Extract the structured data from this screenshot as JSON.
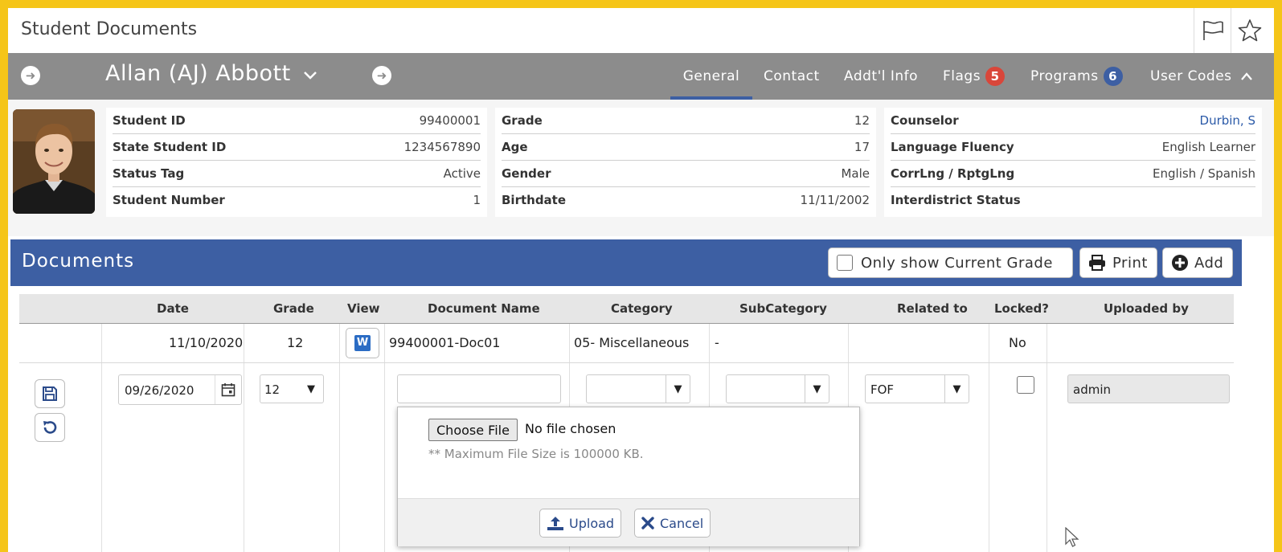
{
  "window": {
    "title": "Student Documents"
  },
  "student": {
    "name": "Allan (AJ) Abbott"
  },
  "tabs": [
    {
      "label": "General",
      "active": true
    },
    {
      "label": "Contact"
    },
    {
      "label": "Addt'l Info"
    },
    {
      "label": "Flags",
      "badge": "5",
      "badge_color": "#d9463a"
    },
    {
      "label": "Programs",
      "badge": "6",
      "badge_color": "#3d5fa3"
    },
    {
      "label": "User Codes"
    }
  ],
  "info": {
    "col1": [
      {
        "label": "Student ID",
        "value": "99400001"
      },
      {
        "label": "State Student ID",
        "value": "1234567890"
      },
      {
        "label": "Status Tag",
        "value": "Active"
      },
      {
        "label": "Student Number",
        "value": "1"
      }
    ],
    "col2": [
      {
        "label": "Grade",
        "value": "12"
      },
      {
        "label": "Age",
        "value": "17"
      },
      {
        "label": "Gender",
        "value": "Male"
      },
      {
        "label": "Birthdate",
        "value": "11/11/2002"
      }
    ],
    "col3": [
      {
        "label": "Counselor",
        "value": "Durbin, S"
      },
      {
        "label": "Language Fluency",
        "value": "English Learner"
      },
      {
        "label": "CorrLng / RptgLng",
        "value": "English / Spanish"
      },
      {
        "label": "Interdistrict Status",
        "value": ""
      }
    ]
  },
  "documents": {
    "title": "Documents",
    "filter_label": "Only show Current Grade",
    "print_label": "Print",
    "add_label": "Add",
    "columns": [
      "Date",
      "Grade",
      "View",
      "Document Name",
      "Category",
      "SubCategory",
      "Related to",
      "Locked?",
      "Uploaded by"
    ],
    "rows": [
      {
        "date": "11/10/2020",
        "grade": "12",
        "view_icon": "W",
        "document_name": "99400001-Doc01",
        "category": "05- Miscellaneous",
        "subcategory": "-",
        "related_to": "",
        "locked": "No",
        "uploaded_by": ""
      }
    ],
    "edit_row": {
      "date": "09/26/2020",
      "grade": "12",
      "document_name": "",
      "category": "",
      "subcategory": "",
      "related_to": "FOF",
      "uploaded_by": "admin"
    },
    "upload": {
      "choose_file_label": "Choose File",
      "no_file_text": "No file chosen",
      "max_size_text": "** Maximum File Size is 100000 KB.",
      "upload_label": "Upload",
      "cancel_label": "Cancel"
    }
  },
  "colors": {
    "accent": "#3d5fa3",
    "navbar": "#8c8c8c",
    "frame": "#f5c518"
  }
}
